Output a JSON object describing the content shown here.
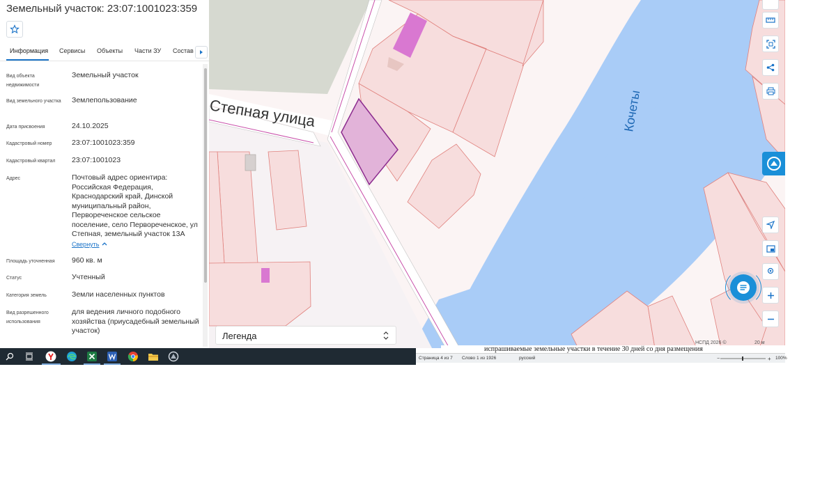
{
  "panel": {
    "title": "Земельный участок: 23:07:1001023:359",
    "tabs": [
      "Информация",
      "Сервисы",
      "Объекты",
      "Части ЗУ",
      "Состав"
    ],
    "rows": [
      {
        "label": "Вид объекта недвижимости",
        "value": "Земельный участок"
      },
      {
        "label": "Вид земельного участка",
        "value": "Землепользование"
      },
      {
        "label": "Дата присвоения",
        "value": "24.10.2025"
      },
      {
        "label": "Кадастровый номер",
        "value": "23:07:1001023:359"
      },
      {
        "label": "Кадастровый квартал",
        "value": "23:07:1001023"
      },
      {
        "label": "Адрес",
        "value": "Почтовый адрес ориентира: Российская Федерация, Краснодарский край, Динской муниципальный район, Первореченское сельское поселение, село Первореченское, ул Степная, земельный участок 13А"
      },
      {
        "label": "Площадь уточненная",
        "value": "960 кв. м"
      },
      {
        "label": "Статус",
        "value": "Учтенный"
      },
      {
        "label": "Категория земель",
        "value": "Земли населенных пунктов"
      },
      {
        "label": "Вид разрешенного использования",
        "value": "для ведения личного подобного хозяйства (приусадебный земельный участок)"
      }
    ],
    "collapse_label": "Свернуть"
  },
  "map": {
    "street_label": "Степная улица",
    "river_label": "Кочеты",
    "legend_label": "Легенда",
    "credit": "НСПД 2026 ©",
    "scale": "20 м",
    "colors": {
      "water": "#a9ccf7",
      "parcel_fill": "#f7dddd",
      "parcel_stroke": "#e0817d",
      "selected": "#e2b3d9",
      "road": "#ffffff"
    }
  },
  "word": {
    "page": "Страница 4 из 7",
    "words": "Слово 1 из 1926",
    "lang": "русский",
    "zoom": "100%",
    "doc_text": "испрашиваемые земельные участки в течение 30 дней со дня размещения"
  }
}
